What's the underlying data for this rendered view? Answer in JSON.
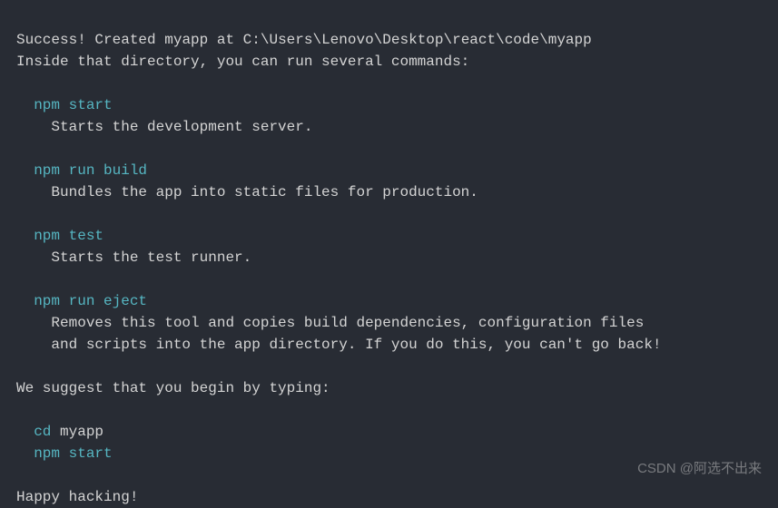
{
  "terminal": {
    "line1_prefix": "Success! Created ",
    "line1_app": "myapp",
    "line1_suffix": " at C:\\Users\\Lenovo\\Desktop\\react\\code\\myapp",
    "line2": "Inside that directory, you can run several commands:",
    "cmd1": "npm start",
    "cmd1_desc": "Starts the development server.",
    "cmd2": "npm run build",
    "cmd2_desc": "Bundles the app into static files for production.",
    "cmd3": "npm test",
    "cmd3_desc": "Starts the test runner.",
    "cmd4": "npm run eject",
    "cmd4_desc1": "Removes this tool and copies build dependencies, configuration files",
    "cmd4_desc2": "and scripts into the app directory. If you do this, you can't go back!",
    "suggest": "We suggest that you begin by typing:",
    "cd_prefix": "cd ",
    "cd_app": "myapp",
    "final_cmd": "npm start",
    "happy": "Happy hacking!"
  },
  "watermark": "CSDN @阿选不出来"
}
